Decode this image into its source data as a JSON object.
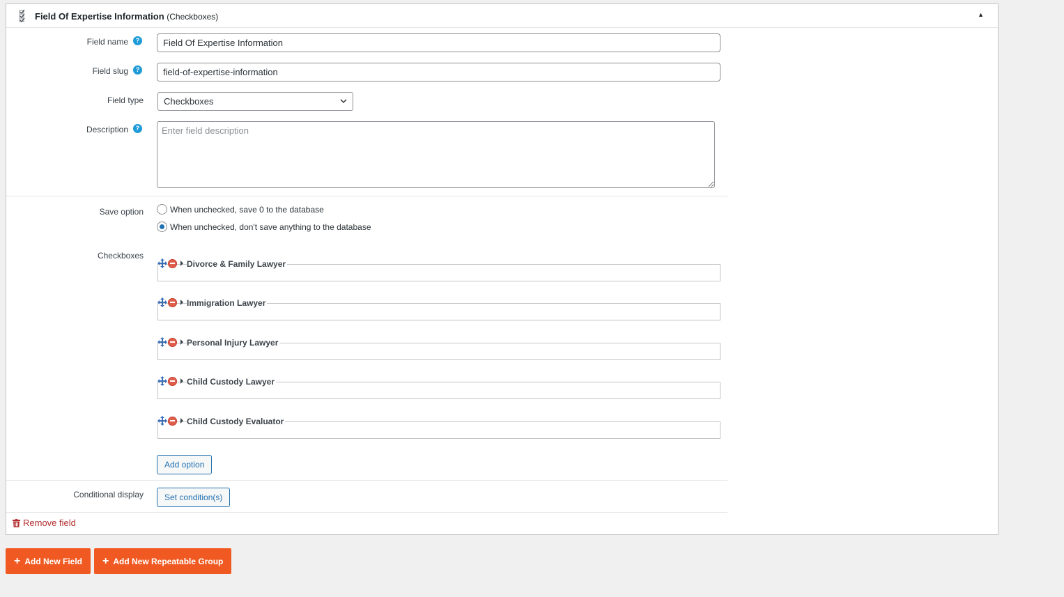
{
  "header": {
    "title": "Field Of Expertise Information",
    "subtitle": "(Checkboxes)",
    "toggle": "▲"
  },
  "form": {
    "field_name": {
      "label": "Field name",
      "value": "Field Of Expertise Information"
    },
    "field_slug": {
      "label": "Field slug",
      "value": "field-of-expertise-information"
    },
    "field_type": {
      "label": "Field type",
      "value": "Checkboxes"
    },
    "description": {
      "label": "Description",
      "placeholder": "Enter field description",
      "value": ""
    },
    "help_glyph": "?"
  },
  "save_option": {
    "label": "Save option",
    "options": [
      {
        "label": "When unchecked, save 0 to the database",
        "checked": false
      },
      {
        "label": "When unchecked, don't save anything to the database",
        "checked": true
      }
    ]
  },
  "checkboxes": {
    "label": "Checkboxes",
    "items": [
      "Divorce & Family Lawyer",
      "Immigration Lawyer",
      "Personal Injury Lawyer",
      "Child Custody Lawyer",
      "Child Custody Evaluator"
    ],
    "add_option_label": "Add option"
  },
  "conditional": {
    "label": "Conditional display",
    "button_label": "Set condition(s)"
  },
  "remove_field_label": "Remove field",
  "footer": {
    "add_field_label": "Add New Field",
    "add_group_label": "Add New Repeatable Group",
    "plus_glyph": "+"
  },
  "colors": {
    "accent": "#2271b1",
    "help": "#1e9bd7",
    "orange": "#f05a22",
    "danger": "#b32d2e"
  },
  "icons": [
    "checkbox-type-icon",
    "collapse-arrow-icon",
    "help-icon",
    "chevron-down-icon",
    "move-icon",
    "remove-option-icon",
    "expand-triangle-icon",
    "trash-icon",
    "plus-icon"
  ]
}
